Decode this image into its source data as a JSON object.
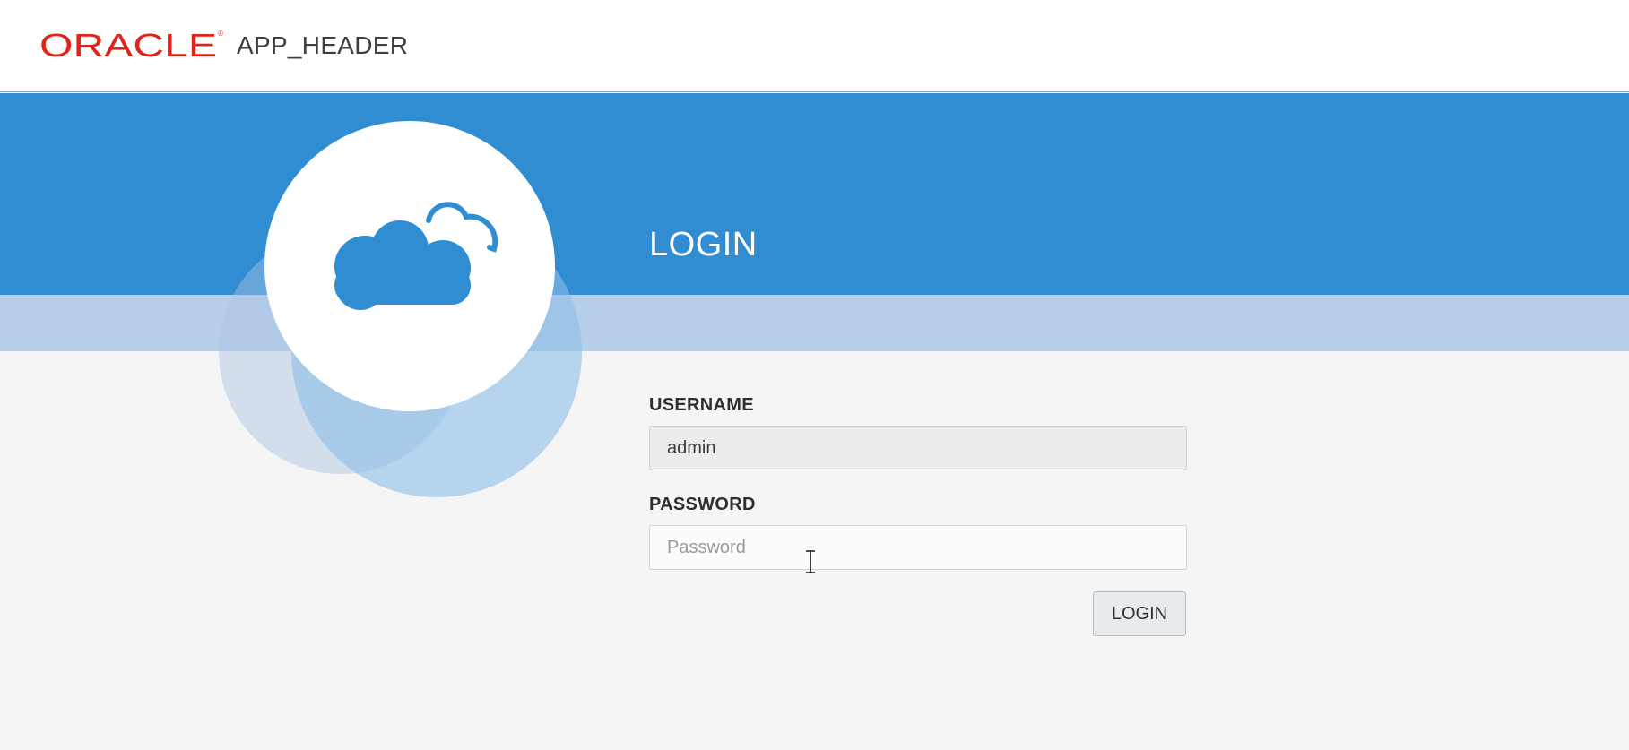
{
  "header": {
    "logo_text": "ORACLE",
    "app_title": "APP_HEADER"
  },
  "login": {
    "title": "LOGIN",
    "username_label": "USERNAME",
    "username_value": "admin",
    "password_label": "PASSWORD",
    "password_placeholder": "Password",
    "button_label": "LOGIN"
  },
  "icons": {
    "brand_image": "cloud-icon",
    "cursor": "text-cursor-icon"
  },
  "colors": {
    "brand_red": "#e2231a",
    "banner_blue": "#318dd2",
    "strip_blue": "#b8cfe9",
    "background": "#f5f5f5"
  }
}
